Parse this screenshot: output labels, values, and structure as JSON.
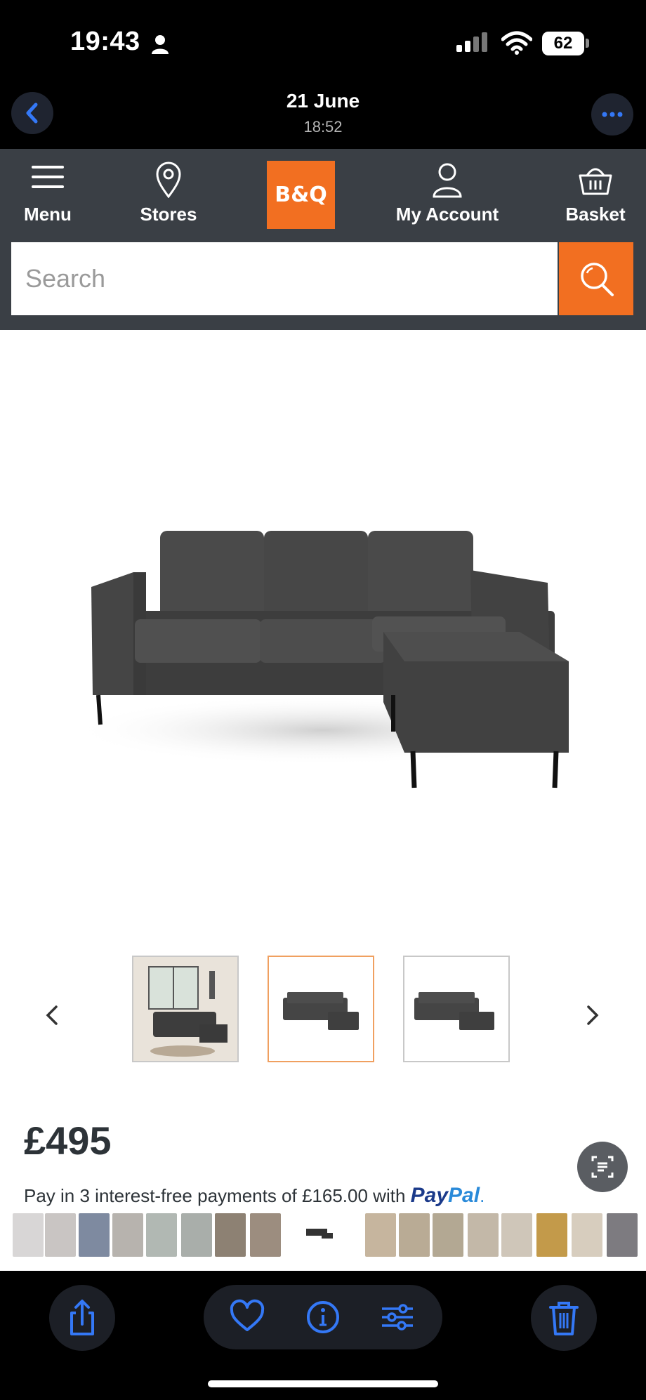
{
  "status_bar": {
    "time": "19:43",
    "battery": "62"
  },
  "header": {
    "date": "21 June",
    "time": "18:52"
  },
  "app_nav": {
    "menu_label": "Menu",
    "stores_label": "Stores",
    "logo_text": "B&Q",
    "account_label": "My Account",
    "basket_label": "Basket"
  },
  "search": {
    "placeholder": "Search"
  },
  "product": {
    "thumbnails": [
      "room-scene",
      "sofa-grey",
      "sofa-grey-outline"
    ],
    "selected_thumbnail": 1,
    "price": "£495",
    "paypal_text": "Pay in 3 interest-free payments of £165.00 with",
    "paypal_logo_1": "Pay",
    "paypal_logo_2": "Pal",
    "paypal_dot": "."
  },
  "colors": {
    "brand_orange": "#f26f21",
    "ios_blue": "#3478f6",
    "nav_grey": "#3a3f45"
  }
}
